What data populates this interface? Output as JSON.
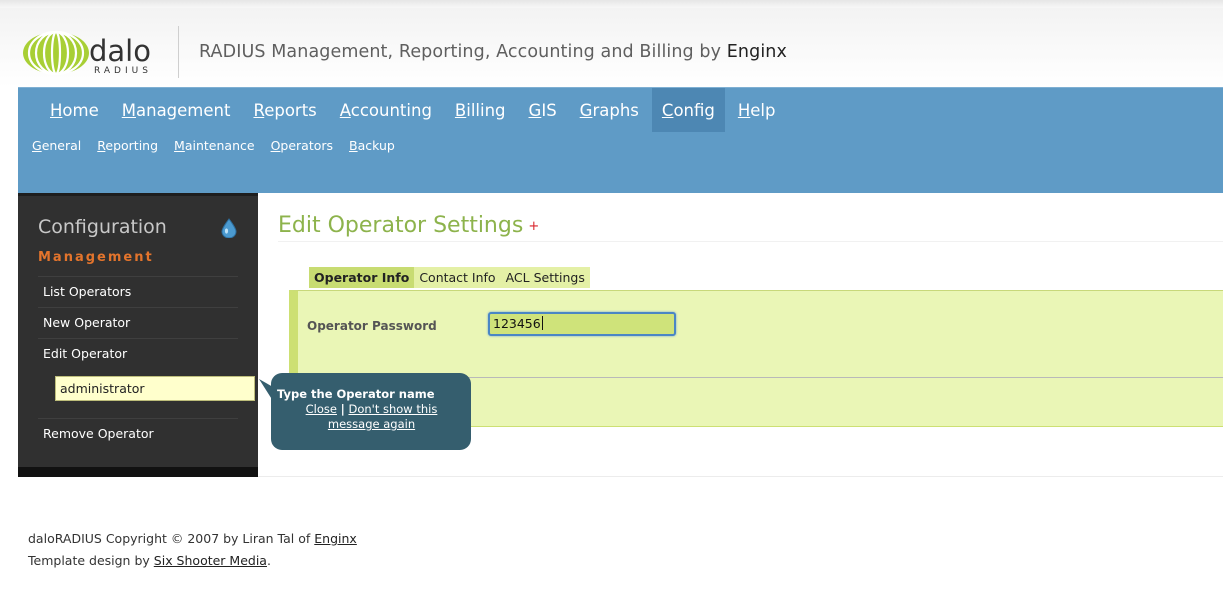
{
  "header": {
    "logo_main": "dalo",
    "logo_sub": "RADIUS",
    "tagline": "RADIUS Management, Reporting, Accounting and Billing by",
    "tagline_brand": "Enginx"
  },
  "nav": {
    "primary": [
      {
        "first": "H",
        "rest": "ome"
      },
      {
        "first": "M",
        "rest": "anagement"
      },
      {
        "first": "R",
        "rest": "eports"
      },
      {
        "first": "A",
        "rest": "ccounting"
      },
      {
        "first": "B",
        "rest": "illing"
      },
      {
        "first": "G",
        "rest": "IS"
      },
      {
        "first": "G",
        "rest": "raphs"
      },
      {
        "first": "C",
        "rest": "onfig"
      },
      {
        "first": "H",
        "rest": "elp"
      }
    ],
    "active_index": 7,
    "secondary": [
      {
        "first": "G",
        "rest": "eneral"
      },
      {
        "first": "R",
        "rest": "eporting"
      },
      {
        "first": "M",
        "rest": "aintenance"
      },
      {
        "first": "O",
        "rest": "perators"
      },
      {
        "first": "B",
        "rest": "ackup"
      }
    ]
  },
  "sidebar": {
    "title": "Configuration",
    "section": "Management",
    "items": [
      "List Operators",
      "New Operator",
      "Edit Operator"
    ],
    "operator_input_value": "administrator",
    "remove_item": "Remove Operator"
  },
  "tooltip": {
    "title": "Type the Operator name",
    "close": "Close",
    "separator": "|",
    "dont_show": "Don't show this message again"
  },
  "main": {
    "title": "Edit Operator Settings",
    "add_symbol": "+",
    "tabs": [
      "Operator Info",
      "Contact Info",
      "ACL Settings"
    ],
    "active_tab": 0,
    "field_label": "Operator Password",
    "field_value": "123456"
  },
  "footer": {
    "line1_prefix": "daloRADIUS Copyright © 2007 by Liran Tal of",
    "line1_link": "Enginx",
    "line2_prefix": "Template design by",
    "line2_link": "Six Shooter Media",
    "line2_suffix": "."
  },
  "colors": {
    "nav_bg": "#5f9bc6",
    "nav_active": "#4d87b3",
    "sidebar_bg": "#303030",
    "section_orange": "#e3742c",
    "title_green": "#8db34c",
    "panel_bg": "#eaf6b6",
    "tooltip_bg": "#355e6e"
  }
}
